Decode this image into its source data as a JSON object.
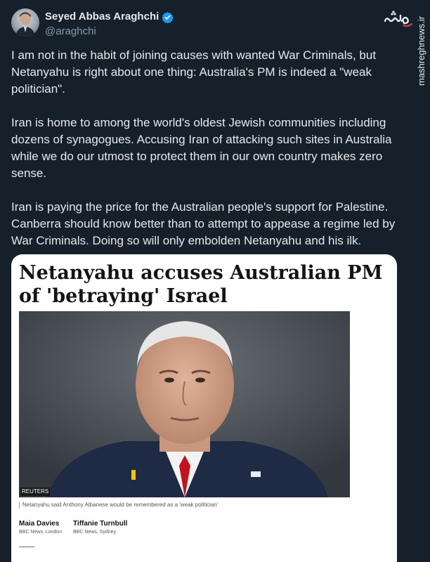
{
  "tweet": {
    "author": {
      "display_name": "Seyed Abbas Araghchi",
      "handle": "@araghchi",
      "verified": true,
      "verified_icon": "verified-badge-icon"
    },
    "paragraphs": [
      "I am not in the habit of joining causes with wanted War Criminals, but Netanyahu is right about one thing: Australia's PM is indeed a \"weak politician\".",
      "Iran is home to among the world's oldest Jewish communities including dozens of synagogues. Accusing Iran of attacking such sites in Australia while we do our utmost to protect them in our own country makes zero sense.",
      "Iran is paying the price for the Australian people's support for Palestine. Canberra should know better than to attempt to appease a regime led by War Criminals. Doing so will only embolden Netanyahu and his ilk."
    ]
  },
  "watermark": {
    "site": "mashreghnews.ir",
    "logo_icon": "mashregh-logo-icon"
  },
  "card": {
    "headline": "Netanyahu accuses Australian PM of 'betraying' Israel",
    "photo_credit": "REUTERS",
    "caption": "Netanyahu said Anthony Albanese would be remembered as a 'weak politician'",
    "authors": [
      {
        "name": "Maia Davies",
        "org": "BBC News, London"
      },
      {
        "name": "Tiffanie Turnbull",
        "org": "BBC News, Sydney"
      }
    ]
  },
  "colors": {
    "background": "#15202b",
    "text_primary": "#e7e9ea",
    "text_secondary": "#8b98a5",
    "verified_blue": "#1d9bf0",
    "card_background": "#ffffff"
  }
}
